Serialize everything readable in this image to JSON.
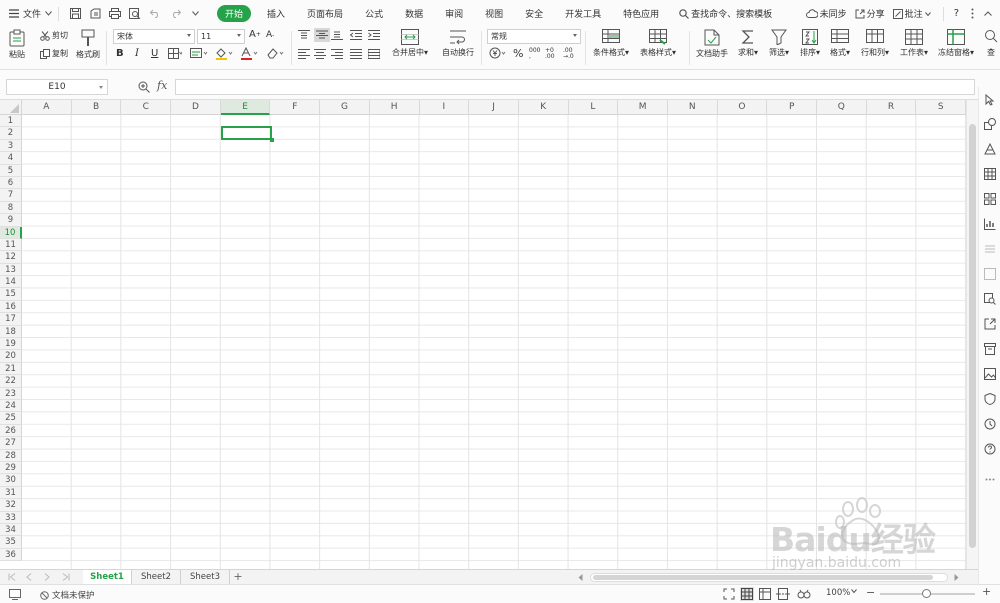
{
  "menubar": {
    "file_menu": "文件",
    "tabs": [
      {
        "label": "开始",
        "active": true
      },
      {
        "label": "插入"
      },
      {
        "label": "页面布局"
      },
      {
        "label": "公式"
      },
      {
        "label": "数据"
      },
      {
        "label": "审阅"
      },
      {
        "label": "视图"
      },
      {
        "label": "安全"
      },
      {
        "label": "开发工具"
      },
      {
        "label": "特色应用"
      }
    ],
    "search_text": "查找命令、搜索模板",
    "sync": "未同步",
    "share": "分享",
    "comment": "批注",
    "help": "?"
  },
  "ribbon": {
    "paste": "粘贴",
    "cut": "剪切",
    "copy": "复制",
    "format_painter": "格式刷",
    "font_name": "宋体",
    "font_size": "11",
    "bold": "B",
    "italic": "I",
    "underline": "U",
    "merge_center": "合并居中",
    "wrap_text": "自动换行",
    "number_format": "常规",
    "percent": "%",
    "conditional_format": "条件格式",
    "table_style": "表格样式",
    "doc_assistant": "文档助手",
    "sum": "求和",
    "filter": "筛选",
    "sort": "排序",
    "format": "格式",
    "row_col": "行和列",
    "worksheet": "工作表",
    "freeze": "冻结窗格",
    "more": "查"
  },
  "formula_bar": {
    "name_box": "E10",
    "fx": "fx"
  },
  "grid": {
    "columns": [
      "A",
      "B",
      "C",
      "D",
      "E",
      "F",
      "G",
      "H",
      "I",
      "J",
      "K",
      "L",
      "M",
      "N",
      "O",
      "P",
      "Q",
      "R",
      "S"
    ],
    "rows": [
      "1",
      "2",
      "3",
      "4",
      "5",
      "6",
      "7",
      "8",
      "9",
      "10",
      "11",
      "12",
      "13",
      "14",
      "15",
      "16",
      "17",
      "18",
      "19",
      "20",
      "21",
      "22",
      "23",
      "24",
      "25",
      "26",
      "27",
      "28",
      "29",
      "30",
      "31",
      "32",
      "33",
      "34",
      "35",
      "36"
    ],
    "selected_column": "E",
    "selected_row": "10"
  },
  "sheets": {
    "tabs": [
      {
        "label": "Sheet1",
        "active": true
      },
      {
        "label": "Sheet2"
      },
      {
        "label": "Sheet3"
      }
    ],
    "add_label": "+"
  },
  "status": {
    "protect": "文档未保护",
    "zoom": "100%",
    "zoom_out": "−",
    "zoom_in": "+"
  },
  "watermark": {
    "brand": "Baidu经验",
    "url": "jingyan.baidu.com"
  },
  "colors": {
    "accent": "#25a24a",
    "selection": "#25a24a",
    "header_bg": "#f3f3f3"
  }
}
